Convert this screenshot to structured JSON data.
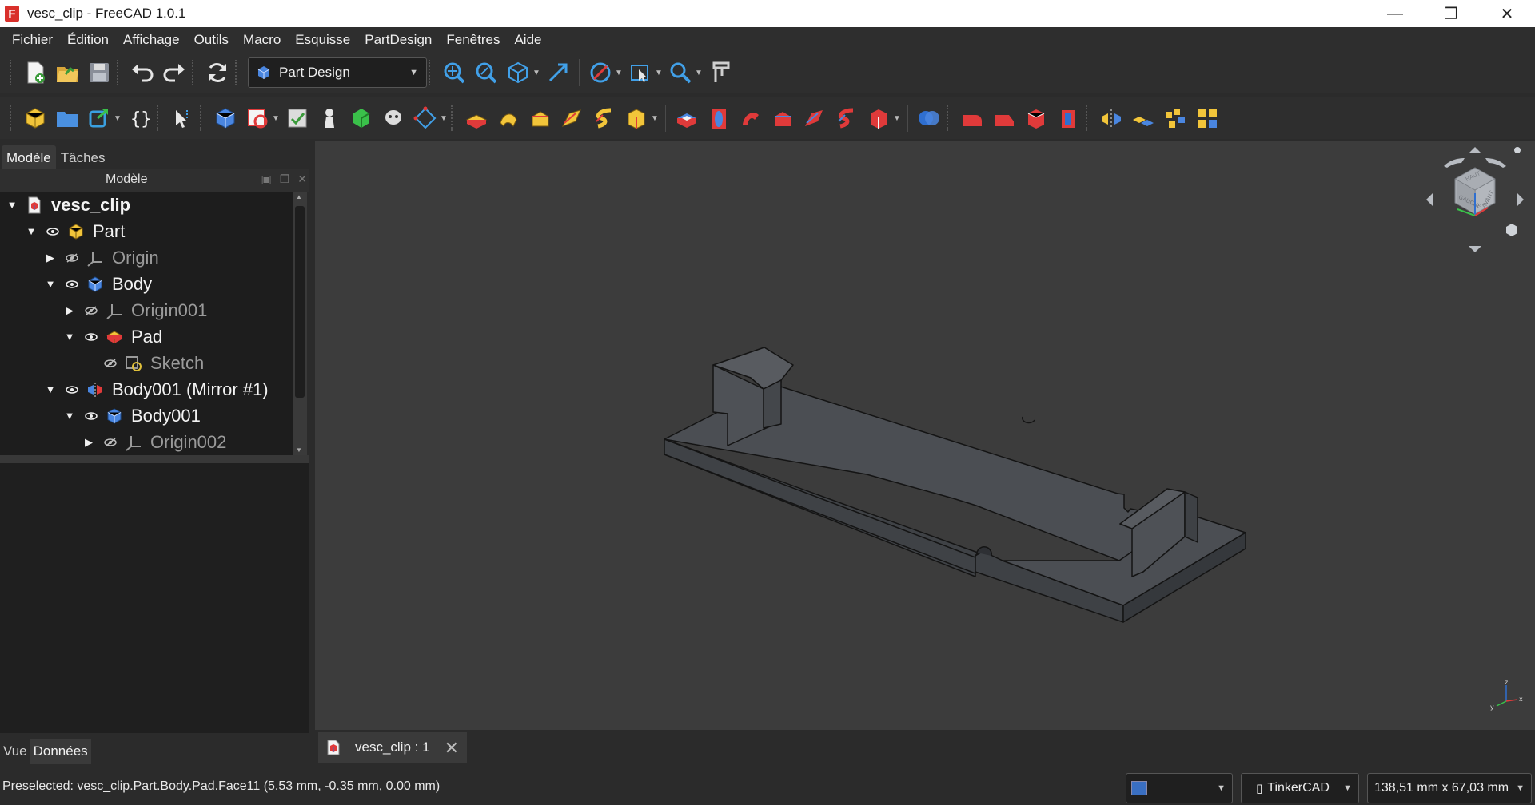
{
  "window": {
    "title": "vesc_clip - FreeCAD 1.0.1",
    "app_icon_letter": "F"
  },
  "menu": [
    {
      "label": "Fichier"
    },
    {
      "label": "Édition"
    },
    {
      "label": "Affichage"
    },
    {
      "label": "Outils"
    },
    {
      "label": "Macro"
    },
    {
      "label": "Esquisse"
    },
    {
      "label": "PartDesign"
    },
    {
      "label": "Fenêtres"
    },
    {
      "label": "Aide"
    }
  ],
  "toolbar": {
    "workbench": "Part Design"
  },
  "left_panel": {
    "tabs": [
      "Modèle",
      "Tâches"
    ],
    "active_tab": "Modèle",
    "header": "Modèle",
    "bottom_tabs": [
      "Vue",
      "Données"
    ],
    "active_bottom_tab": "Données"
  },
  "tree": [
    {
      "label": "vesc_clip",
      "depth": 0,
      "expanded": true,
      "visible_eye": false,
      "icon": "document-icon",
      "style": "bold"
    },
    {
      "label": "Part",
      "depth": 1,
      "expanded": true,
      "visible_eye": true,
      "icon": "part-icon",
      "style": "normal"
    },
    {
      "label": "Origin",
      "depth": 2,
      "expanded": false,
      "visible_eye": false,
      "icon": "origin-icon",
      "style": "dim"
    },
    {
      "label": "Body",
      "depth": 2,
      "expanded": true,
      "visible_eye": true,
      "icon": "body-icon",
      "style": "normal"
    },
    {
      "label": "Origin001",
      "depth": 3,
      "expanded": false,
      "visible_eye": false,
      "icon": "origin-icon",
      "style": "dim"
    },
    {
      "label": "Pad",
      "depth": 3,
      "expanded": true,
      "visible_eye": true,
      "icon": "pad-icon",
      "style": "normal"
    },
    {
      "label": "Sketch",
      "depth": 4,
      "expanded": null,
      "visible_eye": false,
      "icon": "sketch-icon",
      "style": "dim"
    },
    {
      "label": "Body001 (Mirror #1)",
      "depth": 2,
      "expanded": true,
      "visible_eye": true,
      "icon": "mirror-icon",
      "style": "normal"
    },
    {
      "label": "Body001",
      "depth": 3,
      "expanded": true,
      "visible_eye": true,
      "icon": "body-icon",
      "style": "normal"
    },
    {
      "label": "Origin002",
      "depth": 4,
      "expanded": false,
      "visible_eye": false,
      "icon": "origin-icon",
      "style": "dim"
    }
  ],
  "navcube": {
    "faces": [
      "HAUT",
      "GAUCHE",
      "AVANT"
    ]
  },
  "axis": {
    "x": "x",
    "y": "y",
    "z": "z"
  },
  "document_tab": {
    "label": "vesc_clip : 1"
  },
  "status": {
    "preselection": "Preselected: vesc_clip.Part.Body.Pad.Face11 (5.53 mm, -0.35 mm, 0.00 mm)",
    "navigation_style": "TinkerCAD",
    "dimensions": "138,51 mm x 67,03 mm"
  },
  "colors": {
    "background": "#2b2b2b",
    "view_background": "#3c3c3c",
    "model_face": "#4a4d52",
    "model_edge": "#141414",
    "accent_blue": "#3a6fc2"
  }
}
